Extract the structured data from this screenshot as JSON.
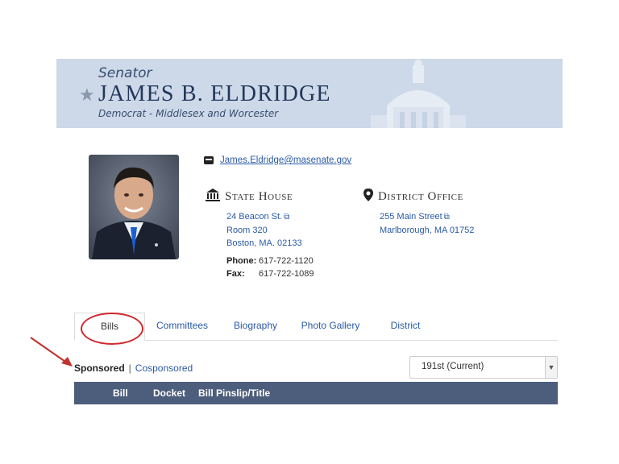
{
  "banner": {
    "title_prefix": "Senator",
    "name": "JAMES B. ELDRIDGE",
    "party": "Democrat - Middlesex and Worcester"
  },
  "contact": {
    "email": "James.Eldridge@masenate.gov",
    "state_house": {
      "heading": "State House",
      "line1": "24 Beacon St.",
      "line2": "Room 320",
      "line3": "Boston, MA. 02133"
    },
    "district_office": {
      "heading": "District Office",
      "line1": "255 Main Street",
      "line2": "Marlborough, MA 01752"
    },
    "phone_label": "Phone:",
    "phone": "617-722-1120",
    "fax_label": "Fax:",
    "fax": "617-722-1089"
  },
  "tabs": [
    {
      "label": "Bills",
      "active": true
    },
    {
      "label": "Committees"
    },
    {
      "label": "Biography"
    },
    {
      "label": "Photo Gallery"
    },
    {
      "label": "District"
    }
  ],
  "filter": {
    "sponsored": "Sponsored",
    "separator": "|",
    "cosponsored": "Cosponsored"
  },
  "session_select": {
    "value": "191st (Current)"
  },
  "table": {
    "columns": [
      "Bill",
      "Docket",
      "Bill Pinslip/Title"
    ]
  },
  "colors": {
    "banner_bg": "#cdd9e9",
    "header_bar": "#4d5e7c",
    "link": "#2a5aa5",
    "annotation": "#d0292e"
  }
}
